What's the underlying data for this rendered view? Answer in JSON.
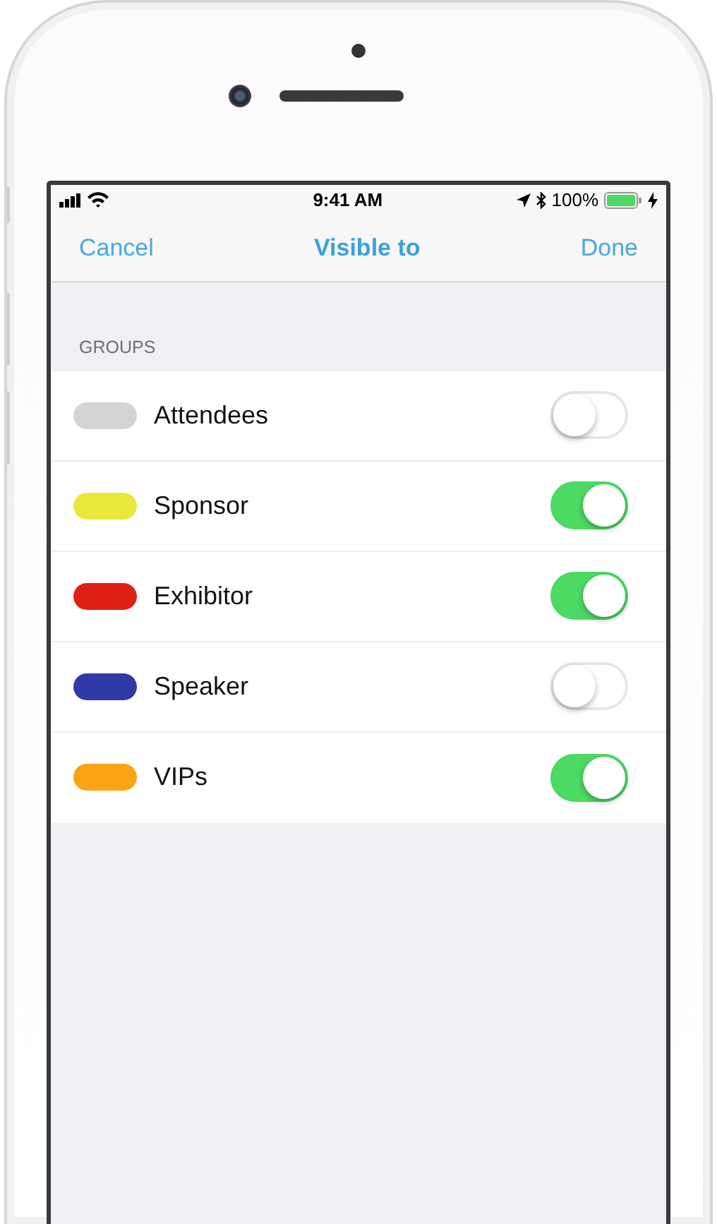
{
  "status_bar": {
    "time": "9:41 AM",
    "battery": "100%"
  },
  "nav_bar": {
    "cancel": "Cancel",
    "title": "Visible to",
    "done": "Done"
  },
  "section_header": "GROUPS",
  "groups": [
    {
      "name": "Attendees",
      "color": "#d3d4d6",
      "on": false
    },
    {
      "name": "Sponsor",
      "color": "#e8e83a",
      "on": true
    },
    {
      "name": "Exhibitor",
      "color": "#e02015",
      "on": true
    },
    {
      "name": "Speaker",
      "color": "#2f3aa6",
      "on": false
    },
    {
      "name": "VIPs",
      "color": "#fca314",
      "on": true
    }
  ]
}
